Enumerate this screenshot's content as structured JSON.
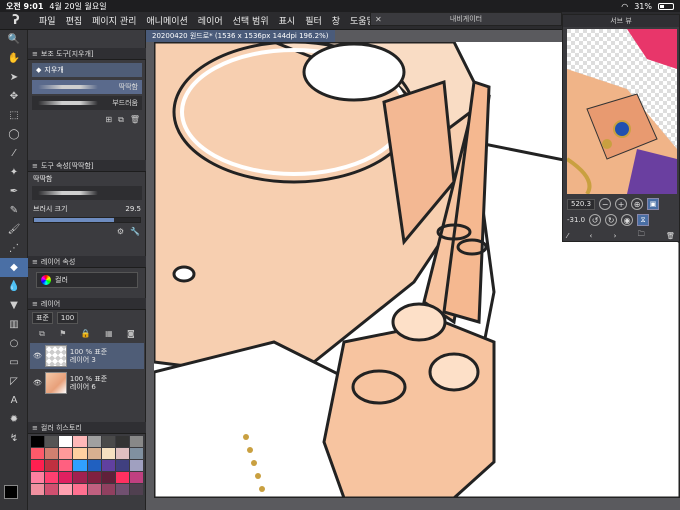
{
  "status_bar": {
    "time": "오전 9:01",
    "date": "4월 20일 월요일",
    "battery": "31%"
  },
  "menu": {
    "items": [
      "파일",
      "편집",
      "페이지 관리",
      "애니메이션",
      "레이어",
      "선택 범위",
      "표시",
      "필터",
      "창",
      "도움말"
    ]
  },
  "navigator_window": {
    "title": "내비게이터",
    "preview_title": "서브 뷰",
    "zoom_value": "520.3",
    "rotation_value": "-31.0"
  },
  "document_tab": {
    "label": "20200420 원드로* (1536 x 1536px 144dpi 196.2%)"
  },
  "subtool_panel": {
    "header": "보조 도구[지우개]",
    "active_tool": "지우개",
    "brushes": [
      {
        "label": "딱딱함",
        "selected": true
      },
      {
        "label": "부드러움",
        "selected": false
      }
    ]
  },
  "tool_property": {
    "header": "도구 속성[딱딱함]",
    "brush_name": "딱딱함",
    "brush_size_label": "브러시 크기",
    "brush_size_value": "29.5",
    "brush_size_fill_pct": 75
  },
  "layer_property": {
    "header": "레이어 속성",
    "color_mode": "컬러"
  },
  "layers": {
    "header": "레이어",
    "blend_mode": "표준",
    "opacity": "100",
    "items": [
      {
        "opacity_blend": "100 % 표준",
        "name": "레이어 3",
        "selected": true,
        "thumb": "check"
      },
      {
        "opacity_blend": "100 % 표준",
        "name": "레이어 6",
        "selected": false,
        "thumb": "art"
      }
    ]
  },
  "color_history": {
    "header": "컬러 히스토리",
    "swatches": [
      "#000000",
      "#555555",
      "#ffffff",
      "#ffb8b8",
      "#a0a0a0",
      "#4a4a4a",
      "#333333",
      "#888888",
      "#ff5a6a",
      "#d08070",
      "#ff9a9a",
      "#ffd0a0",
      "#d8b090",
      "#f5e0c0",
      "#e0c0c0",
      "#8090a0",
      "#ff2050",
      "#c03040",
      "#ff6080",
      "#30a0ff",
      "#2060c0",
      "#6040a0",
      "#404080",
      "#a0a0c0",
      "#ff80a0",
      "#ff4070",
      "#e02060",
      "#a02050",
      "#802040",
      "#60203a",
      "#ff3060",
      "#c04080",
      "#f090a0",
      "#d05070",
      "#ffa0b0",
      "#ff7090",
      "#c06080",
      "#904060",
      "#705070",
      "#504050"
    ]
  },
  "colors": {
    "accent": "#4a6fa5",
    "main_color": "#000000",
    "sub_color": "#ffffff"
  }
}
